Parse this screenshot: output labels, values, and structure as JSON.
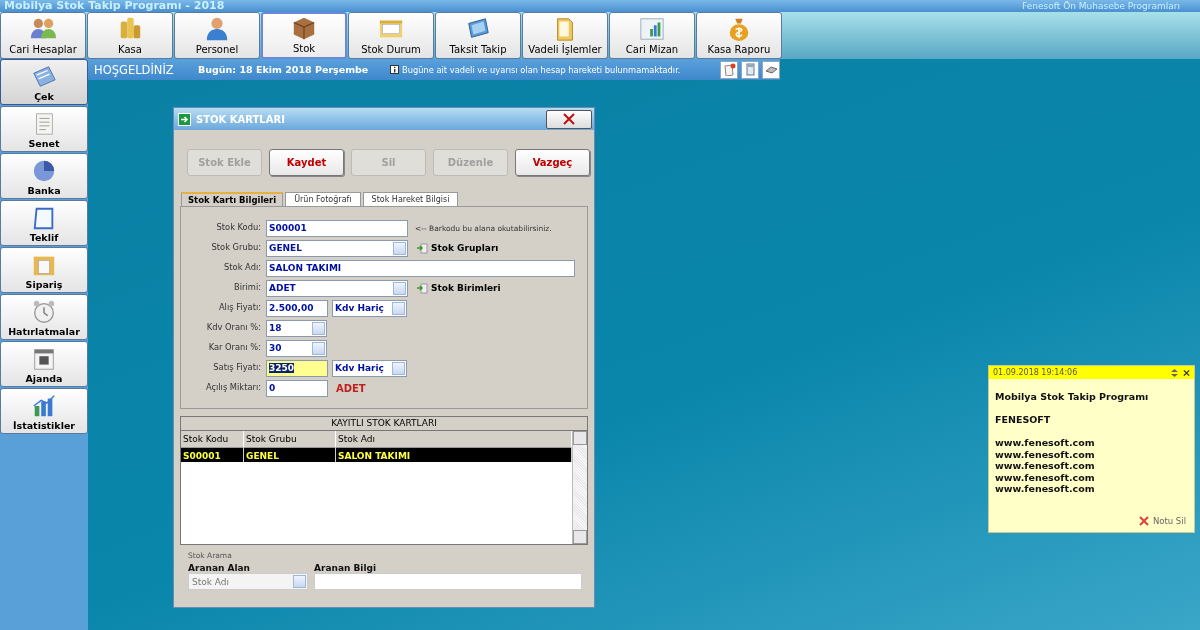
{
  "app": {
    "title": "Mobilya Stok Takip Programı - 2018",
    "subtitle": "Fenesoft Ön Muhasebe Programları"
  },
  "toolbar": [
    {
      "label": "Cari Hesaplar",
      "selected": false
    },
    {
      "label": "Kasa",
      "selected": false
    },
    {
      "label": "Personel",
      "selected": false
    },
    {
      "label": "Stok",
      "selected": true
    },
    {
      "label": "Stok Durum",
      "selected": false
    },
    {
      "label": "Taksit Takip",
      "selected": false
    },
    {
      "label": "Vadeli İşlemler",
      "selected": false
    },
    {
      "label": "Cari Mizan",
      "selected": false
    },
    {
      "label": "Kasa Raporu",
      "selected": false
    }
  ],
  "sidebar": [
    {
      "label": "Çek",
      "selected": true
    },
    {
      "label": "Senet",
      "selected": false
    },
    {
      "label": "Banka",
      "selected": false
    },
    {
      "label": "Teklif",
      "selected": false
    },
    {
      "label": "Sipariş",
      "selected": false
    },
    {
      "label": "Hatırlatmalar",
      "selected": false
    },
    {
      "label": "Ajanda",
      "selected": false
    },
    {
      "label": "İstatistikler",
      "selected": false
    }
  ],
  "info_bar": {
    "welcome": "HOŞGELDİNİZ",
    "date": "Bugün: 18 Ekim 2018 Perşembe",
    "notice": "Bugüne ait vadeli ve uyarısı olan hesap hareketi bulunmamaktadır."
  },
  "dialog": {
    "title": "STOK KARTLARI",
    "actions": [
      {
        "label": "Stok Ekle",
        "disabled": true
      },
      {
        "label": "Kaydet",
        "disabled": false
      },
      {
        "label": "Sil",
        "disabled": true
      },
      {
        "label": "Düzenle",
        "disabled": true
      },
      {
        "label": "Vazgeç",
        "disabled": false
      }
    ],
    "tabs": [
      {
        "label": "Stok Kartı Bilgileri",
        "selected": true
      },
      {
        "label": "Ürün Fotoğrafı",
        "selected": false
      },
      {
        "label": "Stok Hareket Bilgisi",
        "selected": false
      }
    ],
    "fields": [
      {
        "label": "Stok Kodu:",
        "control": {
          "kind": "text",
          "value": "S00001",
          "focused": false
        },
        "extra": {
          "kind": "hint",
          "text": "<-- Barkodu bu alana okutabilirsiniz."
        }
      },
      {
        "label": "Stok Grubu:",
        "control": {
          "kind": "combo",
          "value": "GENEL",
          "focused": false
        },
        "extra": {
          "kind": "link",
          "text": "Stok Grupları"
        }
      },
      {
        "label": "Stok Adı:",
        "control": {
          "kind": "wide-text",
          "value": "SALON TAKIMI",
          "focused": false
        }
      },
      {
        "label": "Birimi:",
        "control": {
          "kind": "combo",
          "value": "ADET",
          "focused": false
        },
        "extra": {
          "kind": "link",
          "text": "Stok Birimleri"
        }
      },
      {
        "label": "Alış Fiyatı:",
        "control": {
          "kind": "short-text",
          "value": "2.500,00",
          "focused": false
        },
        "extra": {
          "kind": "combo",
          "text": "Kdv Hariç"
        }
      },
      {
        "label": "Kdv Oranı %:",
        "control": {
          "kind": "short-combo",
          "value": "18",
          "focused": false
        }
      },
      {
        "label": "Kar Oranı %:",
        "control": {
          "kind": "short-combo",
          "value": "30",
          "focused": false
        }
      },
      {
        "label": "Satış Fiyatı:",
        "control": {
          "kind": "short-text",
          "value": "3250",
          "focused": true
        },
        "extra": {
          "kind": "combo",
          "text": "Kdv Hariç"
        }
      },
      {
        "label": "Açılış Miktarı:",
        "control": {
          "kind": "short-text",
          "value": "0",
          "focused": false
        },
        "extra": {
          "kind": "unit",
          "text": "ADET"
        }
      }
    ],
    "table": {
      "title": "KAYITLI STOK KARTLARI",
      "columns": [
        "Stok Kodu",
        "Stok Grubu",
        "Stok Adı"
      ],
      "rows": [
        {
          "cells": [
            "S00001",
            "GENEL",
            "SALON TAKIMI"
          ],
          "selected": true
        }
      ]
    },
    "search": {
      "title": "Stok Arama",
      "field_label": "Aranan Alan",
      "field_value": "Stok Adı",
      "info_label": "Aranan Bilgi"
    }
  },
  "note": {
    "timestamp": "01.09.2018 19:14:06",
    "paragraphs": [
      [
        "Mobilya Stok Takip Programı"
      ],
      [
        "FENESOFT"
      ],
      [
        "www.fenesoft.com",
        "www.fenesoft.com",
        "www.fenesoft.com",
        "www.fenesoft.com",
        "www.fenesoft.com"
      ]
    ],
    "delete_label": "Notu Sil"
  }
}
